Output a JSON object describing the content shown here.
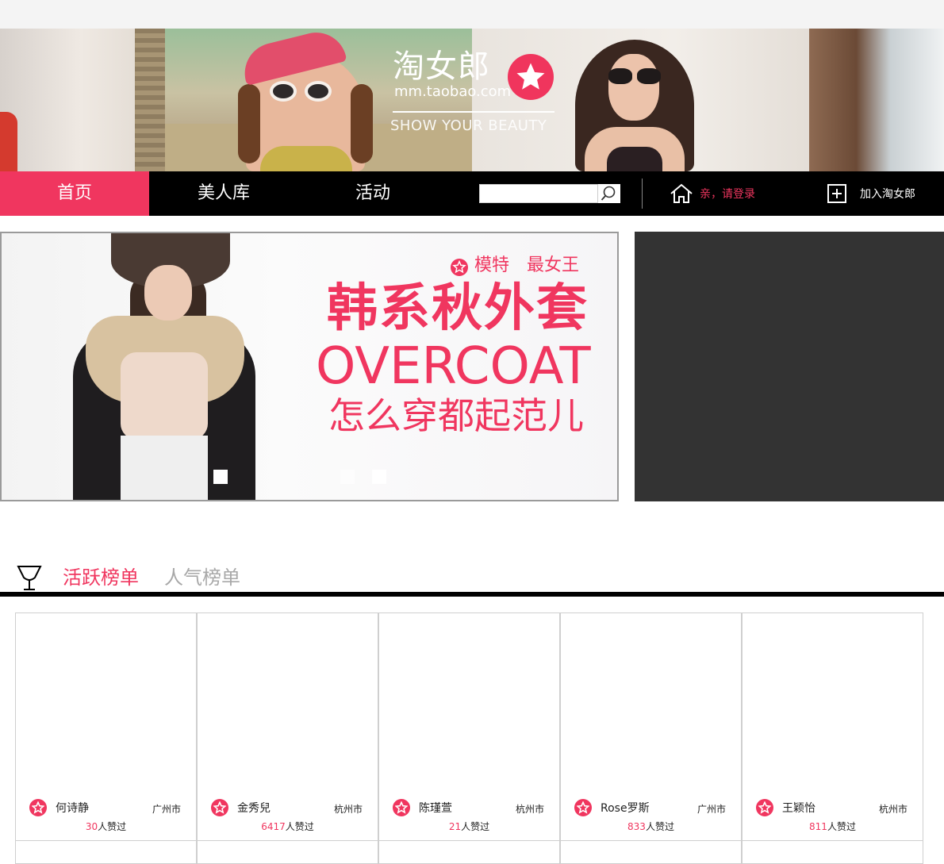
{
  "banner": {
    "logo_text": "淘女郎",
    "logo_domain": "mm.taobao.com",
    "logo_tagline": "SHOW YOUR BEAUTY"
  },
  "nav": {
    "items": [
      {
        "label": "首页",
        "active": true
      },
      {
        "label": "美人库",
        "active": false
      },
      {
        "label": "活动",
        "active": false
      }
    ],
    "search_placeholder": "",
    "login_text": "亲，请登录",
    "join_text": "加入淘女郎"
  },
  "slide": {
    "tagline": "模特　最女王",
    "title": "韩系秋外套",
    "english": "OVERCOAT",
    "subtitle": "怎么穿都起范儿"
  },
  "ranking": {
    "tabs": [
      {
        "label": "活跃榜单",
        "active": true
      },
      {
        "label": "人气榜单",
        "active": false
      }
    ],
    "likes_suffix": "人赞过",
    "cards": [
      {
        "name": "何诗静",
        "city": "广州市",
        "likes": "30"
      },
      {
        "name": "金秀兒",
        "city": "杭州市",
        "likes": "6417"
      },
      {
        "name": "陈瑾萱",
        "city": "杭州市",
        "likes": "21"
      },
      {
        "name": "Rose罗斯",
        "city": "广州市",
        "likes": "833"
      },
      {
        "name": "王颖怡",
        "city": "杭州市",
        "likes": "811"
      }
    ]
  },
  "colors": {
    "accent": "#f0365f",
    "nav_bg": "#000000",
    "sidebox_bg": "#333333"
  }
}
